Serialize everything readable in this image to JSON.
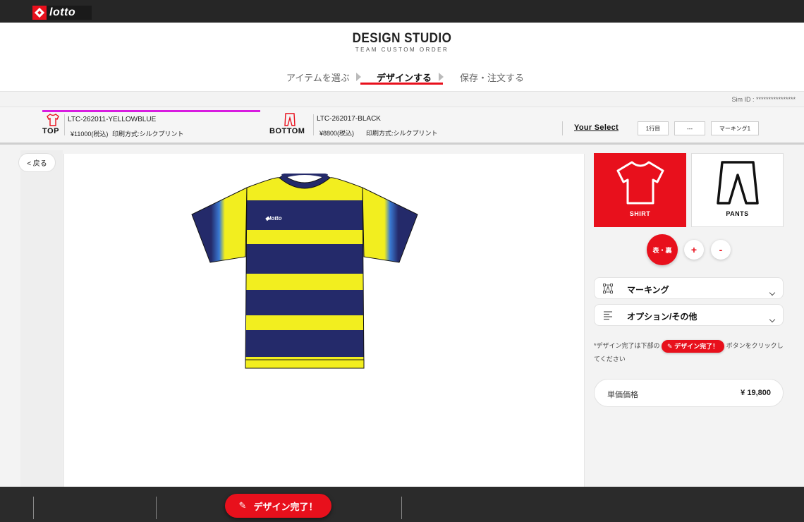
{
  "brand": {
    "logo_text": "lotto"
  },
  "header": {
    "title": "DESIGN STUDIO",
    "subtitle": "TEAM CUSTOM ORDER",
    "steps": [
      {
        "label": "アイテムを選ぶ",
        "active": false
      },
      {
        "label": "デザインする",
        "active": true
      },
      {
        "label": "保存・注文する",
        "active": false
      }
    ]
  },
  "sim_id": "Sim ID : ****************",
  "items": {
    "top": {
      "label": "TOP",
      "code": "LTC-262011-YELLOWBLUE",
      "price": "¥11000(税込)",
      "print": "印刷方式:シルクプリント"
    },
    "bottom": {
      "label": "BOTTOM",
      "code": "LTC-262017-BLACK",
      "price": "¥8800(税込)",
      "print": "印刷方式:シルクプリント"
    }
  },
  "your_select": {
    "label": "Your Select",
    "buttons": [
      "1行目",
      "---",
      "マーキング1"
    ]
  },
  "back_label": "< 戻る",
  "garment_types": [
    {
      "label": "SHIRT",
      "active": true
    },
    {
      "label": "PANTS",
      "active": false
    }
  ],
  "view_controls": {
    "flip": "表・裏",
    "zoom_in": "+",
    "zoom_out": "-"
  },
  "accordions": [
    {
      "label": "マーキング",
      "icon": "marking-icon"
    },
    {
      "label": "オプション/その他",
      "icon": "options-list-icon"
    }
  ],
  "note": {
    "before": "*デザイン完了は下部の",
    "pill": "デザイン完了！",
    "after": "ボタンをクリックしてください"
  },
  "unit_price": {
    "label": "単価価格",
    "value": "¥ 19,800"
  },
  "footer": {
    "finish_label": "デザイン完了！"
  },
  "colors": {
    "accent": "#e8101c",
    "shirt_yellow": "#f2ee1f",
    "shirt_navy": "#242a6a",
    "indicator": "#d81ce0"
  }
}
